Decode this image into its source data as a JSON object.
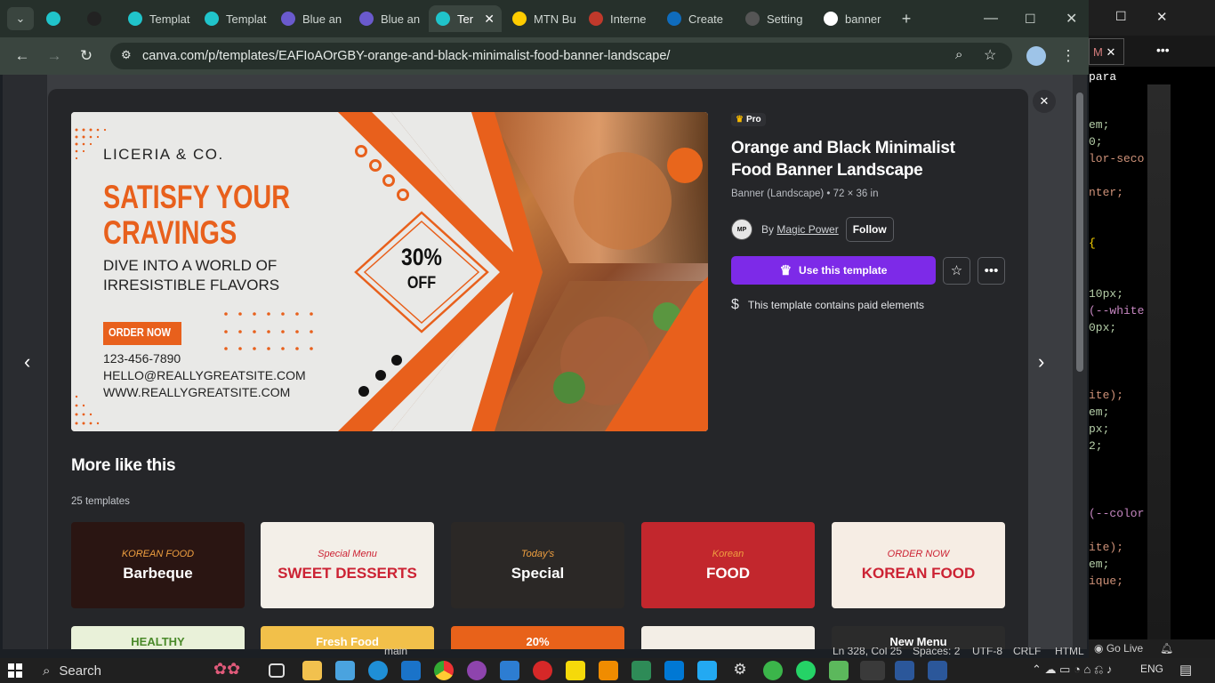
{
  "browser": {
    "tabs": [
      {
        "label": "",
        "icon": "canva-icon"
      },
      {
        "label": "",
        "icon": "ai-icon"
      },
      {
        "label": "Templat",
        "icon": "canva-icon"
      },
      {
        "label": "Templat",
        "icon": "canva-icon"
      },
      {
        "label": "Blue an",
        "icon": "app-icon"
      },
      {
        "label": "Blue an",
        "icon": "app-icon"
      },
      {
        "label": "Ter",
        "icon": "canva-icon",
        "active": true
      },
      {
        "label": "MTN Bu",
        "icon": "mtn-icon"
      },
      {
        "label": "Interne",
        "icon": "gauge-icon"
      },
      {
        "label": "Create",
        "icon": "outlook-icon"
      },
      {
        "label": "Setting",
        "icon": "gear-icon"
      },
      {
        "label": "banner",
        "icon": "google-icon"
      }
    ],
    "url": "canva.com/p/templates/EAFIoAOrGBY-orange-and-black-minimalist-food-banner-landscape/"
  },
  "template": {
    "badge": "Pro",
    "title_line1": "Orange and Black Minimalist",
    "title_line2": "Food Banner Landscape",
    "meta": "Banner (Landscape) • 72 × 36 in",
    "by_label": "By",
    "author": "Magic Power",
    "follow": "Follow",
    "use_button": "Use this template",
    "paid_note": "This template contains paid elements"
  },
  "banner": {
    "company": "LICERIA & CO.",
    "headline1": "SATISFY YOUR",
    "headline2": "CRAVINGS",
    "sub1": "DIVE INTO A WORLD OF",
    "sub2": "IRRESISTIBLE FLAVORS",
    "discount1": "30%",
    "discount2": "OFF",
    "cta": "ORDER NOW",
    "phone": "123-456-7890",
    "email": "HELLO@REALLYGREATSITE.COM",
    "web": "WWW.REALLYGREATSITE.COM"
  },
  "more": {
    "title": "More like this",
    "count": "25 templates",
    "thumbs": [
      {
        "caption": "Barbeque",
        "sub": "KOREAN FOOD",
        "bg": "#2a1512"
      },
      {
        "caption": "SWEET DESSERTS",
        "sub": "Special Menu",
        "bg": "#f3efe8"
      },
      {
        "caption": "Special",
        "sub": "Today's",
        "bg": "#2b2826"
      },
      {
        "caption": "FOOD",
        "sub": "Korean",
        "bg": "#c2272d"
      },
      {
        "caption": "KOREAN FOOD",
        "sub": "ORDER NOW",
        "bg": "#f6ede4"
      }
    ],
    "row2": [
      {
        "caption": "HEALTHY",
        "bg": "#e9f1d9"
      },
      {
        "caption": "Fresh Food",
        "bg": "#f2c04a"
      },
      {
        "caption": "20%",
        "bg": "#e8621a"
      },
      {
        "caption": "",
        "bg": "#f3eee6"
      },
      {
        "caption": "New Menu",
        "bg": "#2b2b2b"
      }
    ]
  },
  "editor": {
    "tab_letter": "M",
    "lines": [
      {
        "text": "para",
        "color": "#ffffff"
      },
      {
        "text": "em;",
        "color": "#b5cea8"
      },
      {
        "text": "0;",
        "color": "#b5cea8"
      },
      {
        "text": "lor-seco",
        "color": "#ce9178"
      },
      {
        "text": "nter;",
        "color": "#ce9178"
      },
      {
        "text": " {",
        "color": "#ffd700"
      },
      {
        "text": "10px;",
        "color": "#b5cea8"
      },
      {
        "text": "(--white",
        "color": "#c586c0"
      },
      {
        "text": "0px;",
        "color": "#b5cea8"
      },
      {
        "text": "ite);",
        "color": "#ce9178"
      },
      {
        "text": "em;",
        "color": "#b5cea8"
      },
      {
        "text": "px;",
        "color": "#b5cea8"
      },
      {
        "text": "2;",
        "color": "#b5cea8"
      },
      {
        "text": "(--color",
        "color": "#c586c0"
      },
      {
        "text": "ite);",
        "color": "#ce9178"
      },
      {
        "text": "em;",
        "color": "#b5cea8"
      },
      {
        "text": "ique;",
        "color": "#ce9178"
      }
    ]
  },
  "statusbar": {
    "branch": "main",
    "cursor": "Ln 328, Col 25",
    "spaces": "Spaces: 2",
    "encoding": "UTF-8",
    "eol": "CRLF",
    "lang": "HTML",
    "golive": "Go Live"
  },
  "taskbar": {
    "search": "Search",
    "lang": "ENG"
  }
}
